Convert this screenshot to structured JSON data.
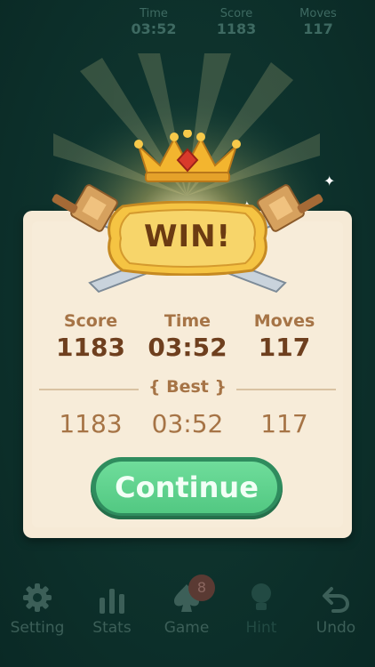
{
  "top_stats": [
    {
      "label": "Time",
      "value": "03:52"
    },
    {
      "label": "Score",
      "value": "1183"
    },
    {
      "label": "Moves",
      "value": "117"
    }
  ],
  "dialog": {
    "title": "WIN!",
    "columns": [
      {
        "label": "Score",
        "value": "1183",
        "best": "1183"
      },
      {
        "label": "Time",
        "value": "03:52",
        "best": "03:52"
      },
      {
        "label": "Moves",
        "value": "117",
        "best": "117"
      }
    ],
    "best_label": "Best",
    "continue_label": "Continue"
  },
  "bottom_tabs": [
    {
      "label": "Setting",
      "icon": "gear-icon"
    },
    {
      "label": "Stats",
      "icon": "bar-chart-icon"
    },
    {
      "label": "Game",
      "icon": "spade-icon",
      "badge": "8"
    },
    {
      "label": "Hint",
      "icon": "lightbulb-icon"
    },
    {
      "label": "Undo",
      "icon": "undo-icon"
    }
  ],
  "colors": {
    "background": "#0e332d",
    "card": "#f6ead6",
    "accent_green": "#52c882",
    "gold": "#f2b632"
  }
}
